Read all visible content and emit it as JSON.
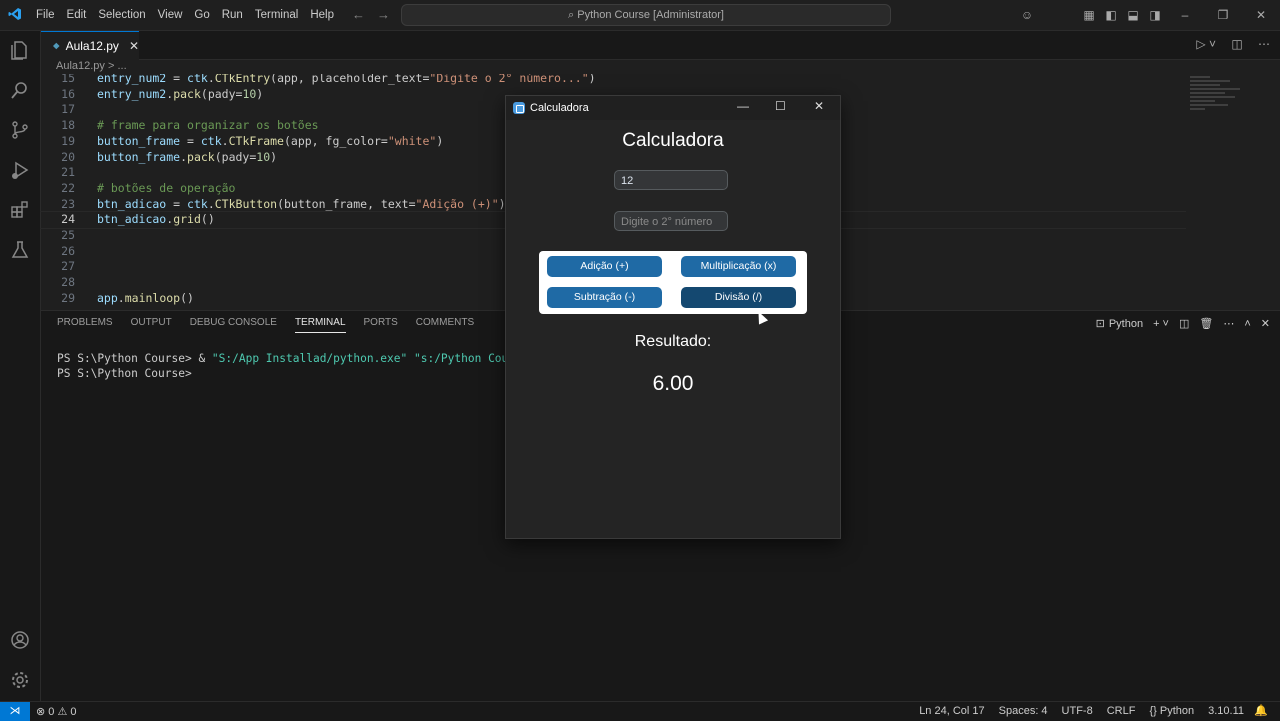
{
  "menu": [
    "File",
    "Edit",
    "Selection",
    "View",
    "Go",
    "Run",
    "Terminal",
    "Help"
  ],
  "command_center": "Python Course [Administrator]",
  "tab": {
    "label": "Aula12.py",
    "close": "✕"
  },
  "breadcrumb": "Aula12.py > ...",
  "editor": {
    "current_line": 24,
    "lines": [
      {
        "n": "15",
        "tokens": [
          [
            "var",
            "entry_num2"
          ],
          [
            "punc",
            " = "
          ],
          [
            "var",
            "ctk"
          ],
          [
            "punc",
            "."
          ],
          [
            "fn",
            "CTkEntry"
          ],
          [
            "punc",
            "(app, placeholder_text="
          ],
          [
            "str",
            "\"Digite o 2° número...\""
          ],
          [
            "punc",
            ")"
          ]
        ]
      },
      {
        "n": "16",
        "tokens": [
          [
            "var",
            "entry_num2"
          ],
          [
            "punc",
            "."
          ],
          [
            "fn",
            "pack"
          ],
          [
            "punc",
            "(pady="
          ],
          [
            "num",
            "10"
          ],
          [
            "punc",
            ")"
          ]
        ]
      },
      {
        "n": "17",
        "tokens": []
      },
      {
        "n": "18",
        "tokens": [
          [
            "com",
            "# frame para organizar os botões"
          ]
        ]
      },
      {
        "n": "19",
        "tokens": [
          [
            "var",
            "button_frame"
          ],
          [
            "punc",
            " = "
          ],
          [
            "var",
            "ctk"
          ],
          [
            "punc",
            "."
          ],
          [
            "fn",
            "CTkFrame"
          ],
          [
            "punc",
            "(app, fg_color="
          ],
          [
            "str",
            "\"white\""
          ],
          [
            "punc",
            ")"
          ]
        ]
      },
      {
        "n": "20",
        "tokens": [
          [
            "var",
            "button_frame"
          ],
          [
            "punc",
            "."
          ],
          [
            "fn",
            "pack"
          ],
          [
            "punc",
            "(pady="
          ],
          [
            "num",
            "10"
          ],
          [
            "punc",
            ")"
          ]
        ]
      },
      {
        "n": "21",
        "tokens": []
      },
      {
        "n": "22",
        "tokens": [
          [
            "com",
            "# botões de operação"
          ]
        ]
      },
      {
        "n": "23",
        "tokens": [
          [
            "var",
            "btn_adicao"
          ],
          [
            "punc",
            " = "
          ],
          [
            "var",
            "ctk"
          ],
          [
            "punc",
            "."
          ],
          [
            "fn",
            "CTkButton"
          ],
          [
            "punc",
            "(button_frame, text="
          ],
          [
            "str",
            "\"Adição (+)\""
          ],
          [
            "punc",
            ")"
          ]
        ]
      },
      {
        "n": "24",
        "tokens": [
          [
            "var",
            "btn_adicao"
          ],
          [
            "punc",
            "."
          ],
          [
            "fn",
            "grid"
          ],
          [
            "punc",
            "()"
          ]
        ]
      },
      {
        "n": "25",
        "tokens": []
      },
      {
        "n": "26",
        "tokens": []
      },
      {
        "n": "27",
        "tokens": []
      },
      {
        "n": "28",
        "tokens": []
      },
      {
        "n": "29",
        "tokens": [
          [
            "var",
            "app"
          ],
          [
            "punc",
            "."
          ],
          [
            "fn",
            "mainloop"
          ],
          [
            "punc",
            "()"
          ]
        ]
      }
    ]
  },
  "panel": {
    "tabs": [
      "PROBLEMS",
      "OUTPUT",
      "DEBUG CONSOLE",
      "TERMINAL",
      "PORTS",
      "COMMENTS"
    ],
    "active_tab": "TERMINAL",
    "terminal_profile": "Python",
    "terminal_lines": [
      {
        "prompt": "PS S:\\Python Course> & ",
        "cmd": "\"S:/App Installad/python.exe\" \"s:/Python Course/Aula"
      },
      {
        "prompt": "PS S:\\Python Course>",
        "cmd": ""
      }
    ]
  },
  "status": {
    "errors": "0",
    "warnings": "0",
    "position": "Ln 24, Col 17",
    "spaces": "Spaces: 4",
    "encoding": "UTF-8",
    "eol": "CRLF",
    "language": "{} Python",
    "version": "3.10.11"
  },
  "calc": {
    "window_title": "Calculadora",
    "heading": "Calculadora",
    "entry1_value": "12",
    "entry2_placeholder": "Digite o 2° número",
    "buttons": {
      "add": "Adição (+)",
      "mul": "Multiplicação (x)",
      "sub": "Subtração (-)",
      "div": "Divisão (/)"
    },
    "result_label": "Resultado:",
    "result_value": "6.00"
  },
  "colors": {
    "accent": "#0078d4",
    "ctk_button": "#1f6aa5",
    "ctk_button_hover": "#144870"
  }
}
